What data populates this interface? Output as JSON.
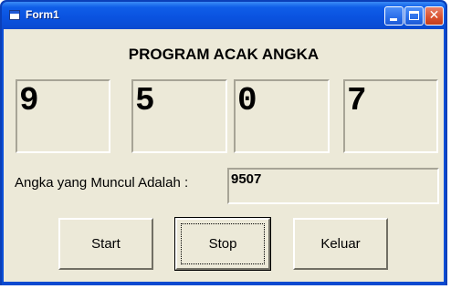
{
  "window": {
    "title": "Form1"
  },
  "heading": "PROGRAM ACAK ANGKA",
  "digits": [
    "9",
    "5",
    "0",
    "7"
  ],
  "result": {
    "label": "Angka yang Muncul Adalah :",
    "value": "9507"
  },
  "buttons": {
    "start": "Start",
    "stop": "Stop",
    "exit": "Keluar"
  },
  "colors": {
    "titlebar": "#0a52df",
    "client": "#ece9d8",
    "close_button": "#d9502e"
  },
  "icons": {
    "app": "form-icon",
    "minimize": "minimize-icon",
    "maximize": "maximize-icon",
    "close": "close-icon"
  }
}
